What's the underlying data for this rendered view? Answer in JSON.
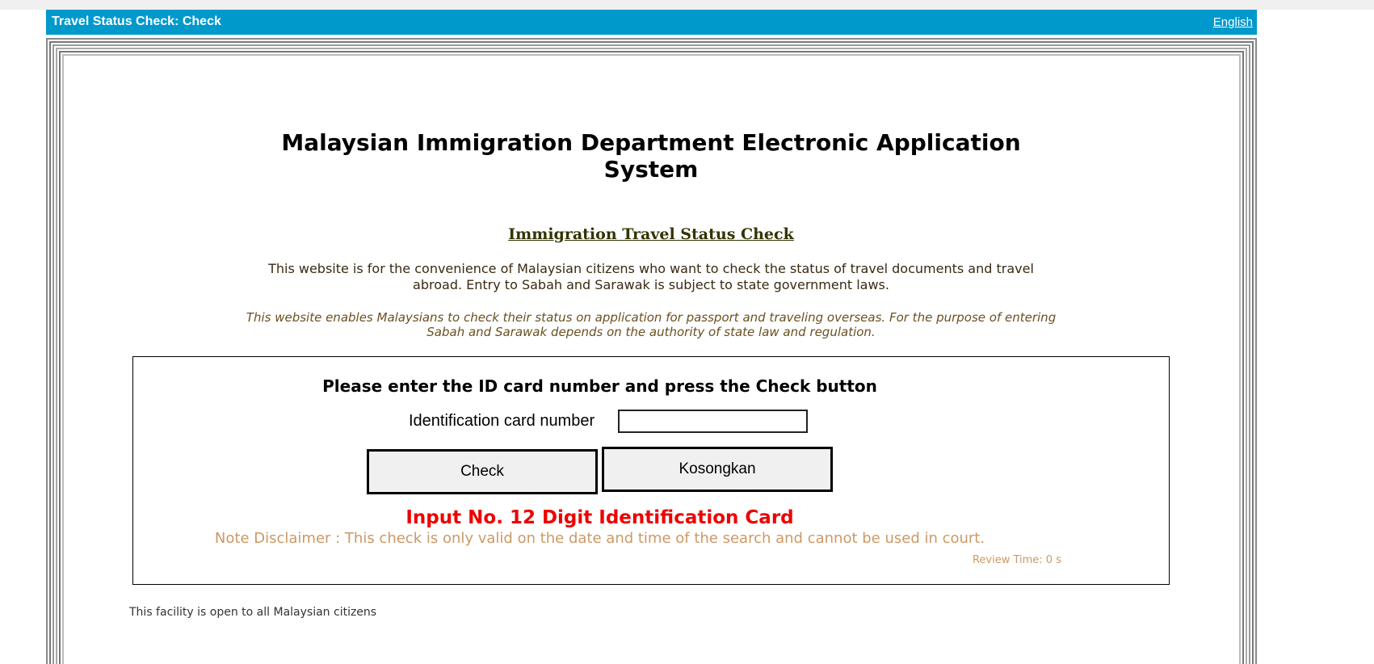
{
  "header": {
    "title": "Travel Status Check: Check",
    "language_link": "English"
  },
  "main": {
    "title": "Malaysian Immigration Department Electronic Application System",
    "subtitle": "Immigration Travel Status Check",
    "description": "This website is for the convenience of Malaysian citizens who want to check the status of travel documents and travel abroad. Entry to Sabah and Sarawak is subject to state government laws.",
    "description_alt": "This website enables Malaysians to check their status on application for passport and traveling overseas. For the purpose of entering Sabah and Sarawak depends on the authority of state law and regulation."
  },
  "form": {
    "prompt": "Please enter the ID card number and press the Check button",
    "id_label": "Identification card number",
    "id_value": "",
    "check_button": "Check",
    "clear_button": "Kosongkan",
    "error_message": "Input No. 12 Digit Identification Card",
    "disclaimer": "Note Disclaimer : This check is only valid on the date and time of the search and cannot be used in court.",
    "review_time": "Review Time: 0 s"
  },
  "footer": {
    "text": "This facility is open to all Malaysian citizens"
  },
  "colors": {
    "header_bg": "#0099cc",
    "error": "#ee0000",
    "disclaimer": "#cc9966"
  }
}
